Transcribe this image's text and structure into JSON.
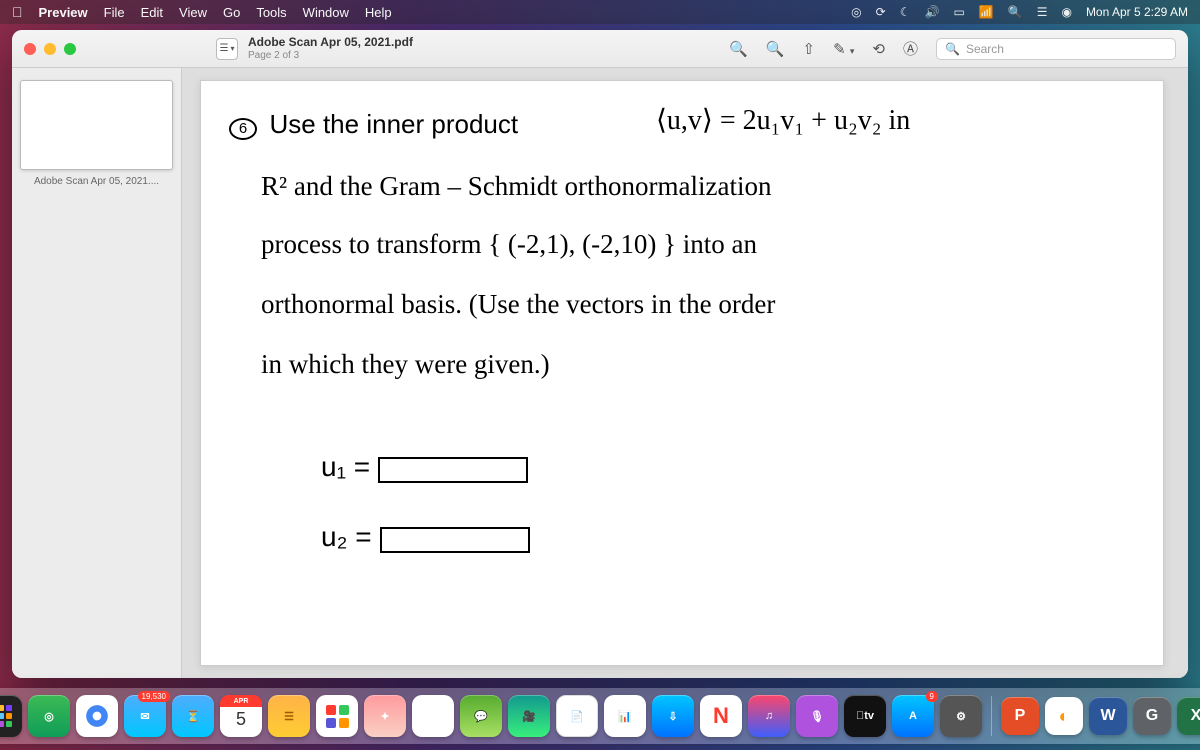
{
  "menubar": {
    "app": "Preview",
    "items": [
      "File",
      "Edit",
      "View",
      "Go",
      "Tools",
      "Window",
      "Help"
    ],
    "clock": "Mon Apr 5  2:29 AM"
  },
  "window": {
    "filename": "Adobe Scan Apr 05, 2021.pdf",
    "page_info": "Page 2 of 3",
    "search_placeholder": "Search",
    "sidebar_thumb_label": "Adobe Scan Apr 05, 2021...."
  },
  "handwriting": {
    "problem_num": "6",
    "l1a": "Use   the   inner   product",
    "l1b": "⟨u,v⟩ = 2u₁v₁ + u₂v₂  in",
    "l2": "R²   and   the   Gram – Schmidt   orthonormalization",
    "l3": "process  to   transform   { (-2,1), (-2,10) }  into  an",
    "l4": "orthonormal  basis.  (Use  the  vectors  in  the  order",
    "l5": "in  which  they   were   given.)",
    "u1": "u₁ =",
    "u2": "u₂ ="
  },
  "dock": {
    "mail_badge": "19,530",
    "cal_month": "APR",
    "cal_day": "5",
    "appstore_badge": "9",
    "tv_label": "tv",
    "p_label": "P",
    "w_label": "W",
    "x_label": "X"
  }
}
